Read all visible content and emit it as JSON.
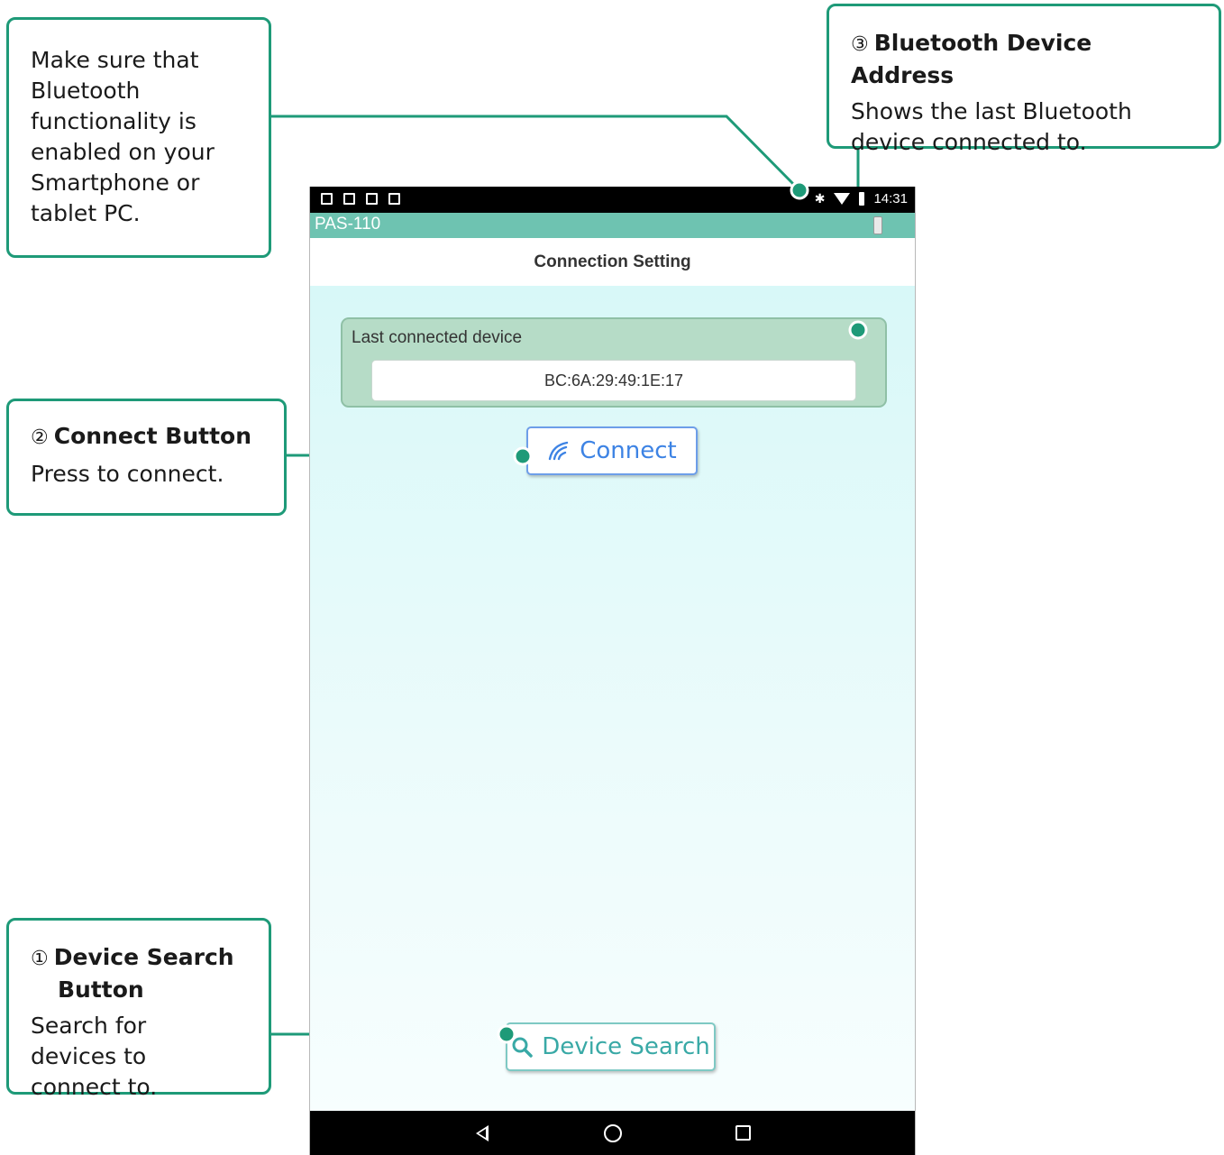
{
  "status_bar": {
    "time": "14:31",
    "bluetooth_icon": "bluetooth-icon",
    "wifi_icon": "wifi-icon",
    "battery_icon": "battery-icon"
  },
  "app_bar": {
    "title": "PAS-110"
  },
  "screen": {
    "title": "Connection Setting",
    "last_device_label": "Last connected device",
    "last_device_address": "BC:6A:29:49:1E:17",
    "connect_label": "Connect",
    "device_search_label": "Device Search"
  },
  "callouts": {
    "bluetooth_note": "Make sure that Bluetooth functionality is enabled on your Smartphone or tablet PC.",
    "address": {
      "number": "③",
      "title": "Bluetooth Device Address",
      "desc": "Shows the last Bluetooth device connected to."
    },
    "connect": {
      "number": "②",
      "title": "Connect Button",
      "desc": "Press to connect."
    },
    "search": {
      "number": "①",
      "title_line1": "Device Search",
      "title_line2": "Button",
      "desc": "Search for devices to connect to."
    }
  },
  "colors": {
    "callout_green": "#1e9a78",
    "app_bar": "#6ec3b1",
    "connect_blue": "#3d83e4",
    "search_teal": "#39a9a6"
  }
}
